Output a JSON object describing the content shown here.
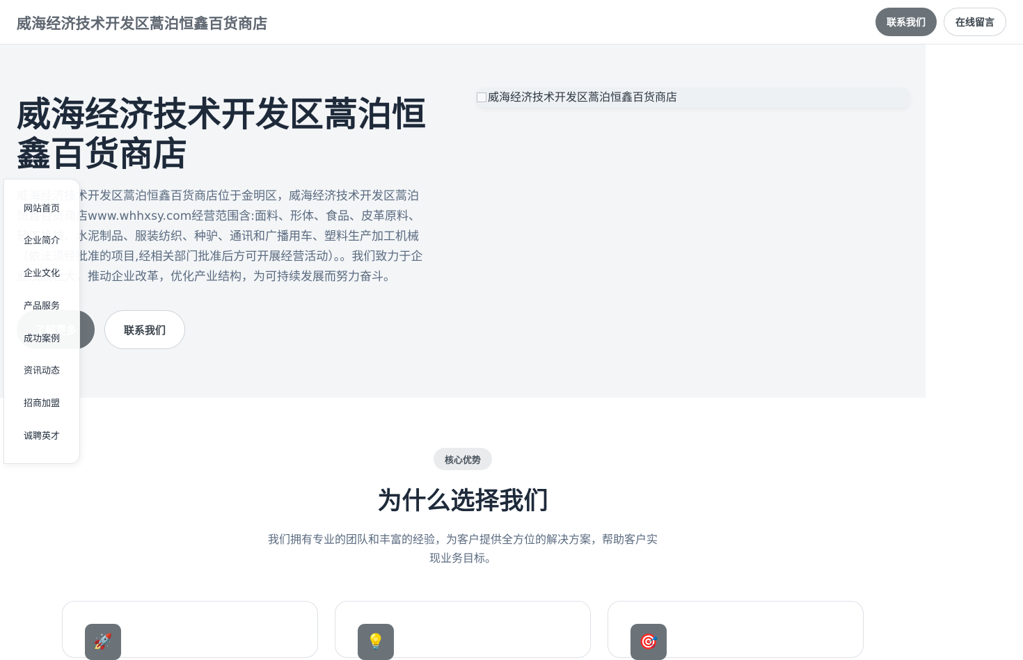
{
  "header": {
    "brand": "威海经济技术开发区蒿泊恒鑫百货商店",
    "contact_label": "联系我们",
    "message_label": "在线留言"
  },
  "hero": {
    "title": "威海经济技术开发区蒿泊恒鑫百货商店",
    "description": "威海经济技术开发区蒿泊恒鑫百货商店位于金明区，威海经济技术开发区蒿泊恒鑫百货商店www.whhxsy.com经营范围含:面料、形体、食品、皮革原料、轻工机械、水泥制品、服装纺织、种驴、通讯和广播用车、塑料生产加工机械（依法须经批准的项目,经相关部门批准后方可开展经营活动）。。我们致力于企业发展壮大，推动企业改革，优化产业结构，为可持续发展而努力奋斗。",
    "primary_button": "了解更多",
    "secondary_button": "联系我们",
    "image_alt": "威海经济技术开发区蒿泊恒鑫百货商店"
  },
  "sidenav": {
    "items": [
      {
        "label": "网站首页"
      },
      {
        "label": "企业简介"
      },
      {
        "label": "企业文化"
      },
      {
        "label": "产品服务"
      },
      {
        "label": "成功案例"
      },
      {
        "label": "资讯动态"
      },
      {
        "label": "招商加盟"
      },
      {
        "label": "诚聘英才"
      }
    ]
  },
  "features": {
    "badge": "核心优势",
    "title": "为什么选择我们",
    "subtitle": "我们拥有专业的团队和丰富的经验，为客户提供全方位的解决方案，帮助客户实现业务目标。",
    "cards": [
      {
        "icon": "🚀",
        "icon_name": "rocket-icon"
      },
      {
        "icon": "💡",
        "icon_name": "lightbulb-icon"
      },
      {
        "icon": "🎯",
        "icon_name": "target-icon"
      }
    ]
  },
  "colors": {
    "accent": "#6b7379",
    "hero_bg": "#f3f5f7",
    "heading": "#1e2a3a",
    "body_text": "#5b6b80"
  }
}
